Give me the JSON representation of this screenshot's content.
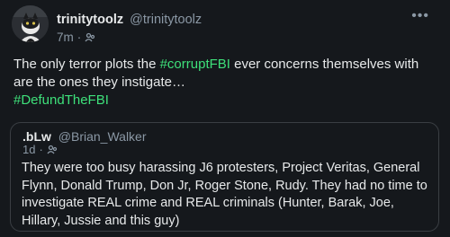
{
  "tweet": {
    "display_name": "trinitytoolz",
    "handle": "@trinitytoolz",
    "time": "7m",
    "separator": "·",
    "more_label": "•••",
    "text_before": "The only terror plots the ",
    "hashtag1": "#corruptFBI",
    "text_after": " ever concerns themselves with are the ones they instigate…",
    "hashtag2": "#DefundTheFBI",
    "hashtag_color": "#3ee07a"
  },
  "quote": {
    "display_name": ".bLw",
    "handle": "@Brian_Walker",
    "time": "1d",
    "separator": "·",
    "text": "They were too busy harassing J6 protesters, Project Veritas, General Flynn, Donald Trump, Don Jr, Roger Stone, Rudy. They had no time to investigate REAL crime and REAL criminals (Hunter, Barak, Joe, Hillary, Jussie and this guy)"
  },
  "icons": {
    "avatar": "avatar-cat-icon",
    "audience": "audience-icon",
    "more": "more-options-icon"
  }
}
